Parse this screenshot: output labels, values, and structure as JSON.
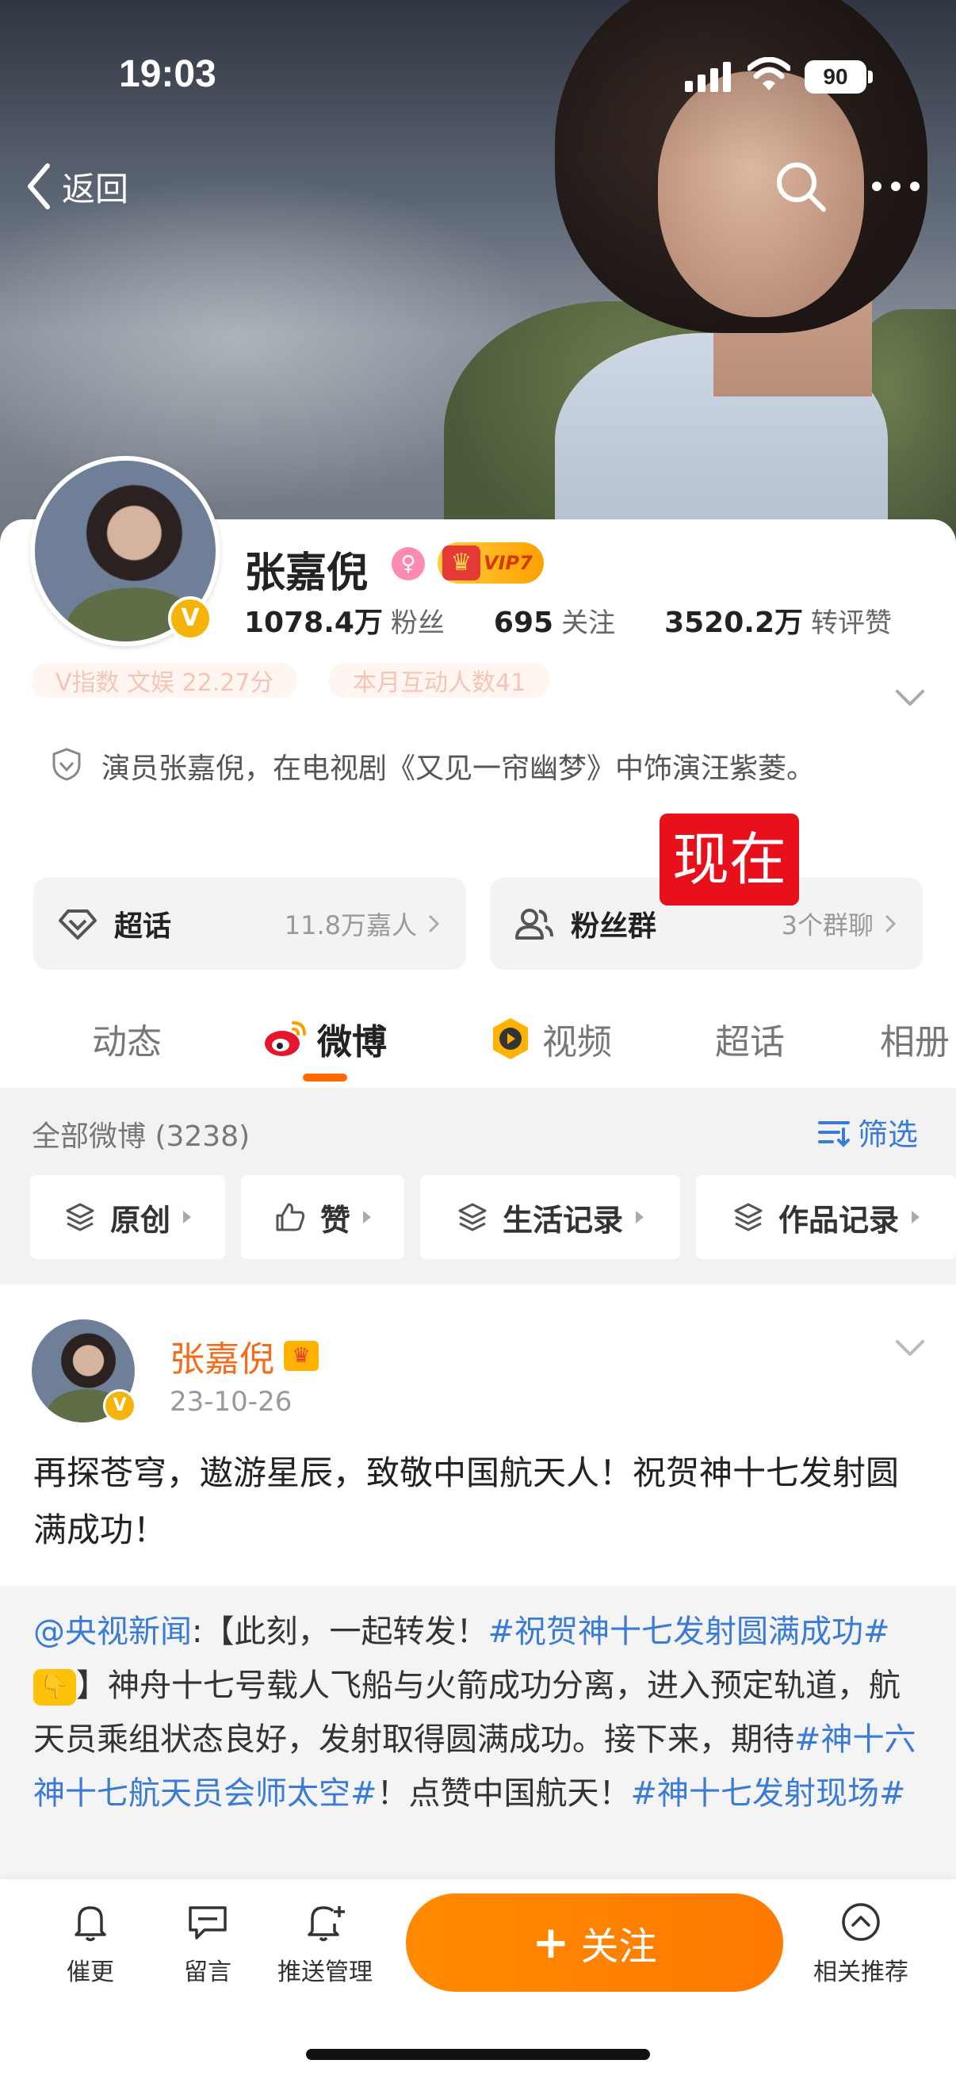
{
  "status_bar": {
    "time": "19:03",
    "battery": "90"
  },
  "nav": {
    "back_label": "返回"
  },
  "profile": {
    "name": "张嘉倪",
    "vip_label": "VIP7",
    "badge": "V",
    "followers": {
      "value": "1078.4万",
      "label": "粉丝"
    },
    "following": {
      "value": "695",
      "label": "关注"
    },
    "interactions": {
      "value": "3520.2万",
      "label": "转评赞"
    },
    "faded_tags": [
      "V指数 文娱 22.27分",
      "本月互动人数41"
    ],
    "bio": "演员张嘉倪，在电视剧《又见一帘幽梦》中饰演汪紫菱。"
  },
  "tiles": {
    "super_topic": {
      "label": "超话",
      "value": "11.8万嘉人"
    },
    "fan_group": {
      "label": "粉丝群",
      "value": "3个群聊"
    }
  },
  "overlay_tag": "现在",
  "tabs": [
    "动态",
    "微博",
    "视频",
    "超话",
    "相册"
  ],
  "active_tab": "微博",
  "filter": {
    "title": "全部微博 (3238)",
    "button": "筛选",
    "chips": [
      "原创",
      "赞",
      "生活记录",
      "作品记录"
    ]
  },
  "post": {
    "author": "张嘉倪",
    "date": "23-10-26",
    "text": "再探苍穹，遨游星辰，致敬中国航天人！祝贺神十七发射圆满成功！",
    "repost": {
      "source": "@央视新闻",
      "part1": ":【此刻，一起转发！",
      "hashtag1": "#祝贺神十七发射圆满成功#",
      "part2": "】神舟十七号载人飞船与火箭成功分离，进入预定轨道，航天员乘组状态良好，发射取得圆满成功。接下来，期待",
      "hashtag2": "#神十六神十七航天员会师太空#",
      "part3": "！点赞中国航天！",
      "hashtag3": "#神十七发射现场#"
    }
  },
  "bottom_bar": {
    "urge": "催更",
    "message": "留言",
    "push": "推送管理",
    "follow": "关注",
    "follow_plus": "+",
    "recommend": "相关推荐"
  },
  "colors": {
    "accent": "#ff7a00",
    "link": "#3a7bd5",
    "name": "#f56b1b",
    "tag_red": "#e8101a"
  }
}
